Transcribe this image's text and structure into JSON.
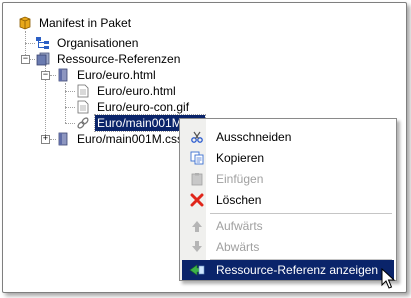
{
  "tree": {
    "root": {
      "label": "Manifest in Paket",
      "icon": "package-icon"
    },
    "organisationen": {
      "label": "Organisationen",
      "icon": "organization-icon"
    },
    "ressource_referenzen": {
      "label": "Ressource-Referenzen",
      "icon": "resources-icon",
      "expander": "−"
    },
    "euro_html": {
      "label": "Euro/euro.html",
      "icon": "resource-icon",
      "expander": "−"
    },
    "children": [
      {
        "label": "Euro/euro.html",
        "icon": "file-icon"
      },
      {
        "label": "Euro/euro-con.gif",
        "icon": "file-icon"
      },
      {
        "label": "Euro/main001M.css",
        "icon": "link-icon",
        "selected": true
      }
    ],
    "main001m": {
      "label": "Euro/main001M.css",
      "icon": "resource-icon",
      "expander": "+"
    }
  },
  "context_menu": {
    "items": [
      {
        "label": "Ausschneiden",
        "icon": "scissors-icon",
        "disabled": false
      },
      {
        "label": "Kopieren",
        "icon": "copy-icon",
        "disabled": false
      },
      {
        "label": "Einfügen",
        "icon": "paste-icon",
        "disabled": true
      },
      {
        "label": "Löschen",
        "icon": "delete-icon",
        "disabled": false
      },
      {
        "label": "Aufwärts",
        "icon": "arrow-up-icon",
        "disabled": true
      },
      {
        "label": "Abwärts",
        "icon": "arrow-down-icon",
        "disabled": true
      },
      {
        "label": "Ressource-Referenz anzeigen",
        "icon": "show-reference-icon",
        "disabled": false,
        "highlighted": true
      }
    ]
  },
  "colors": {
    "selection": "#0a246a",
    "disabled_text": "#a0a0a0",
    "menu_strip": "#f0f0ee"
  }
}
